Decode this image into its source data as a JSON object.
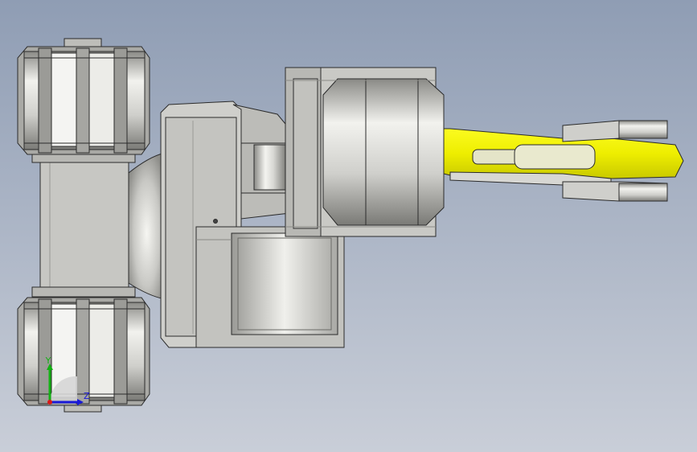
{
  "view": {
    "background_top": "#8f9db4",
    "background_bottom": "#c9ced8",
    "body_color": "#c3c3bf",
    "edge_color": "#2b2b2b",
    "arm_color": "#f2f000"
  },
  "triad": {
    "y_label": "Y",
    "z_label": "Z",
    "y_color": "#12b012",
    "z_color": "#1a1ad8",
    "x_color": "#d81818"
  }
}
